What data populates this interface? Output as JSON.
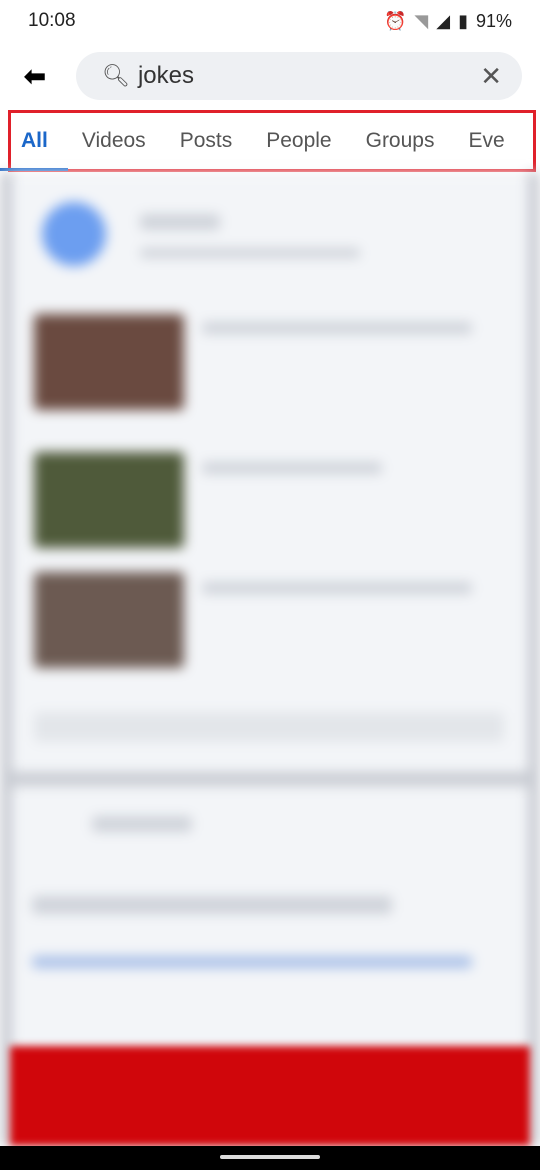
{
  "status_bar": {
    "time": "10:08",
    "battery": "91%",
    "icons": [
      "alarm-icon",
      "wifi-off-icon",
      "signal-icon",
      "battery-icon"
    ]
  },
  "search": {
    "value": "jokes",
    "back_icon": "back-arrow-icon",
    "search_icon": "search-icon",
    "clear_icon": "close-icon"
  },
  "tabs": [
    {
      "label": "All",
      "active": true
    },
    {
      "label": "Videos"
    },
    {
      "label": "Posts"
    },
    {
      "label": "People"
    },
    {
      "label": "Groups"
    },
    {
      "label": "Eve"
    }
  ],
  "colors": {
    "accent": "#1b67c9",
    "highlight_box": "#e0202a"
  }
}
